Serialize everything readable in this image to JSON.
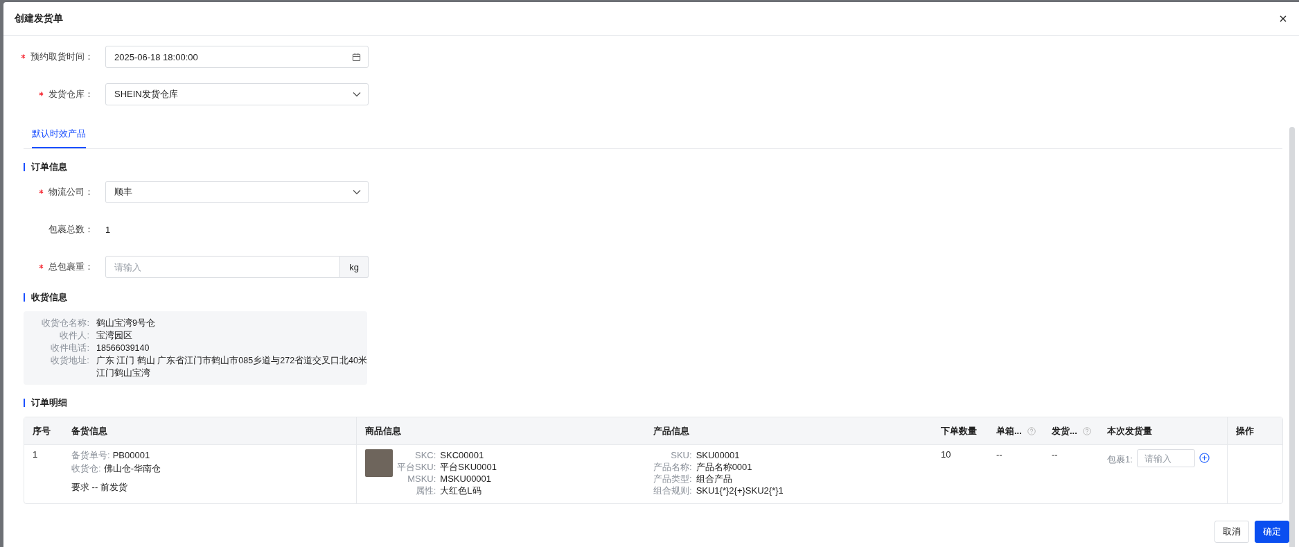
{
  "dialog": {
    "title": "创建发货单"
  },
  "form": [
    {
      "label": "预约取货时间：",
      "required": true,
      "kind": "date",
      "value": "2025-06-18 18:00:00"
    },
    {
      "label": "发货仓库：",
      "required": true,
      "kind": "select",
      "value": "SHEIN发货仓库"
    }
  ],
  "tabs": [
    {
      "label": "默认时效产品",
      "selected": true
    }
  ],
  "order_info": {
    "title": "订单信息",
    "fields": [
      {
        "label": "物流公司：",
        "required": true,
        "kind": "select",
        "value": "顺丰"
      },
      {
        "label": "包裹总数：",
        "required": false,
        "kind": "text",
        "value": "1"
      },
      {
        "label": "总包裹重：",
        "required": true,
        "kind": "unit_input",
        "placeholder": "请输入",
        "unit": "kg"
      }
    ]
  },
  "receiving_info": {
    "title": "收货信息",
    "rows": [
      {
        "label": "收货仓名称:",
        "lines": [
          "鹤山宝湾9号仓"
        ]
      },
      {
        "label": "收件人:",
        "lines": [
          "宝湾园区"
        ]
      },
      {
        "label": "收件电话:",
        "lines": [
          "18566039140"
        ]
      },
      {
        "label": "收货地址:",
        "lines": [
          "广东 江门 鹤山 广东省江门市鹤山市085乡道与272省道交叉口北40米",
          "江门鹤山宝湾"
        ]
      }
    ]
  },
  "order_detail": {
    "title": "订单明细",
    "columns": [
      {
        "label": "序号",
        "help": false
      },
      {
        "label": "备货信息",
        "help": false
      },
      {
        "label": "商品信息",
        "help": false
      },
      {
        "label": "产品信息",
        "help": false
      },
      {
        "label": "下单数量",
        "help": false
      },
      {
        "label": "单箱...",
        "help": true
      },
      {
        "label": "发货...",
        "help": true
      },
      {
        "label": "本次发货量",
        "help": false
      },
      {
        "label": "操作",
        "help": false
      }
    ],
    "rows": [
      {
        "index": "1",
        "stock": [
          {
            "label": "备货单号:",
            "value": "PB00001"
          },
          {
            "label": "收货仓:",
            "value": "佛山仓-华南仓"
          }
        ],
        "requirement": "要求 -- 前发货",
        "goods": [
          {
            "label": "SKC:",
            "value": "SKC00001"
          },
          {
            "label": "平台SKU:",
            "value": "平台SKU0001"
          },
          {
            "label": "MSKU:",
            "value": "MSKU00001"
          },
          {
            "label": "属性:",
            "value": "大红色L码"
          }
        ],
        "product": [
          {
            "label": "SKU:",
            "value": "SKU00001"
          },
          {
            "label": "产品名称:",
            "value": "产品名称0001"
          },
          {
            "label": "产品类型:",
            "value": "组合产品"
          },
          {
            "label": "组合规则:",
            "value": "SKU1{*}2{+}SKU2{*}1"
          }
        ],
        "quantity": "10",
        "per_box": "--",
        "shipped": "--",
        "package_label": "包裹1:",
        "placeholder": "请输入"
      }
    ]
  },
  "buttons": [
    {
      "label": "取消",
      "kind": "default"
    },
    {
      "label": "确定",
      "kind": "primary"
    }
  ]
}
